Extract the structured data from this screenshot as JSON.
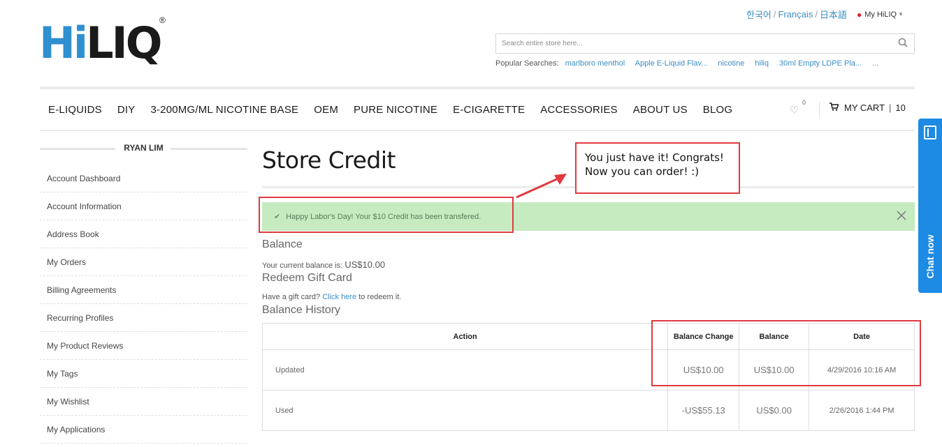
{
  "header": {
    "logo_hi": "Hi",
    "logo_liq": "LIQ",
    "logo_reg": "®",
    "lang_korean": "한국어",
    "lang_french": "Français",
    "lang_japanese": "日本語",
    "lang_sep": "/",
    "my_account": "My HiLIQ",
    "search_placeholder": "Search entire store here...",
    "popular_label": "Popular Searches:",
    "popular": [
      "marlboro menthol",
      "Apple E-Liquid Flav...",
      "nicotine",
      "hiliq",
      "30ml Empty LDPE Pla...",
      "..."
    ]
  },
  "nav": {
    "items": [
      "E-LIQUIDS",
      "DIY",
      "3-200MG/ML NICOTINE BASE",
      "OEM",
      "PURE NICOTINE",
      "E-CIGARETTE",
      "ACCESSORIES",
      "ABOUT US",
      "BLOG"
    ],
    "wishlist_count": "0",
    "cart_label": "MY CART",
    "cart_sep": "|",
    "cart_count": "10"
  },
  "sidebar": {
    "title": "RYAN LIM",
    "items": [
      "Account Dashboard",
      "Account Information",
      "Address Book",
      "My Orders",
      "Billing Agreements",
      "Recurring Profiles",
      "My Product Reviews",
      "My Tags",
      "My Wishlist",
      "My Applications"
    ]
  },
  "main": {
    "title": "Store Credit",
    "success_message": "Happy Labor's Day! Your $10 Credit has been transfered.",
    "balance_heading": "Balance",
    "current_balance_label": "Your current balance is:",
    "current_balance_value": "US$10.00",
    "redeem_heading": "Redeem Gift Card",
    "gift_prefix": "Have a gift card?",
    "gift_link": "Click here",
    "gift_suffix": "to redeem it.",
    "history_heading": "Balance History",
    "table": {
      "headers": [
        "Action",
        "Balance Change",
        "Balance",
        "Date"
      ],
      "rows": [
        [
          "Updated",
          "US$10.00",
          "US$10.00",
          "4/29/2016 10:16 AM"
        ],
        [
          "Used",
          "-US$55.13",
          "US$0.00",
          "2/26/2016 1:44 PM"
        ]
      ]
    }
  },
  "annotation": {
    "line1": "You just have it! Congrats!",
    "line2": "Now you can order! :)",
    "color": "#e0393e"
  },
  "chat": {
    "label": "Chat now",
    "color": "#1d8ae3"
  }
}
